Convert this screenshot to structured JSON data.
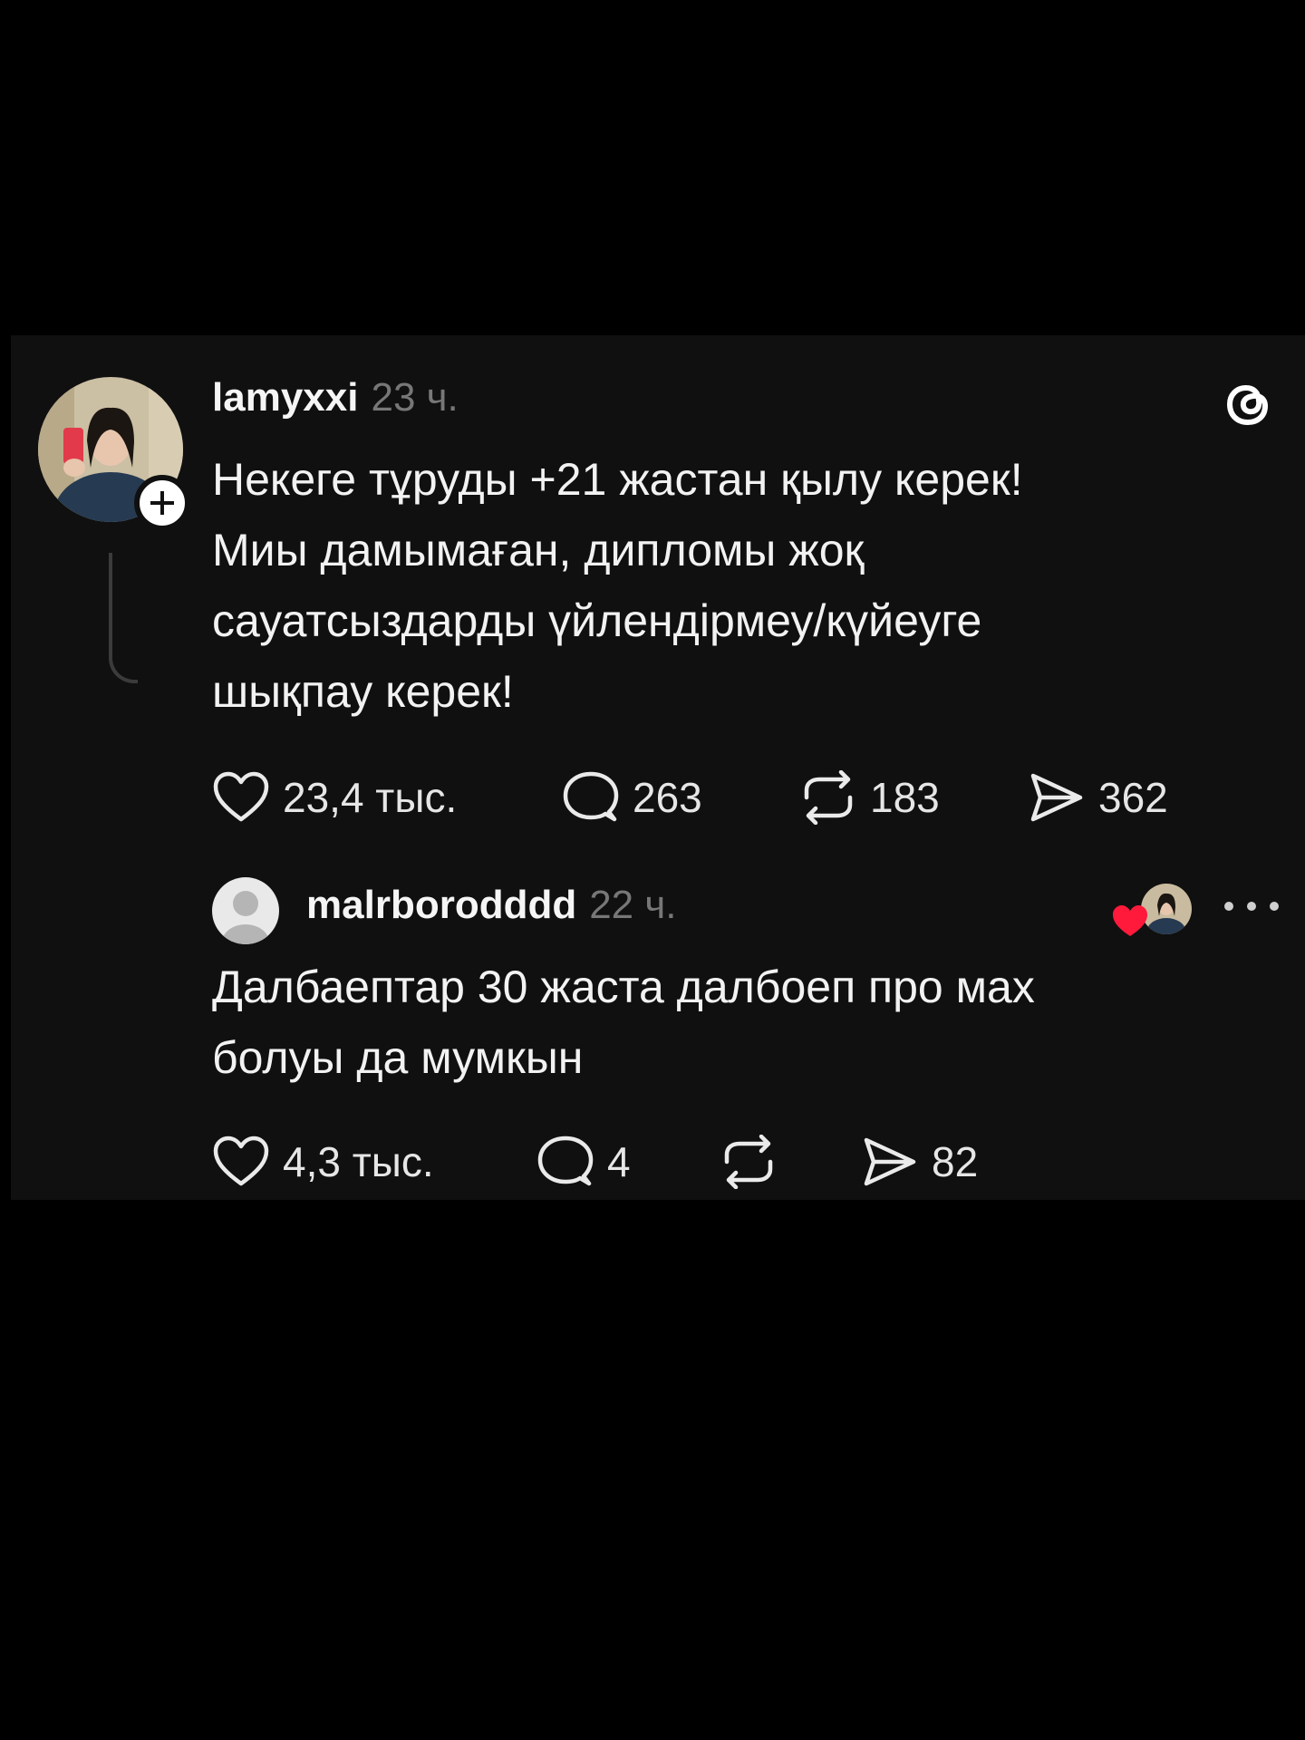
{
  "post": {
    "username": "lamyxxi",
    "time": "23 ч.",
    "text": "Некеге тұруды +21 жастан қылу керек!\nМиы дамымаған, дипломы жоқ\nсауатсыздарды үйлендірмеу/күйеуге\nшықпау керек!",
    "actions": {
      "likes": "23,4 тыс.",
      "comments": "263",
      "reposts": "183",
      "shares": "362"
    }
  },
  "reply": {
    "username": "malrborodddd",
    "time": "22 ч.",
    "text": "Далбаептар 30 жаста далбоеп про мах\nболуы да мумкын",
    "actions": {
      "likes": "4,3 тыс.",
      "comments": "4",
      "reposts": "",
      "shares": "82"
    }
  },
  "icons": [
    "threads-logo-icon",
    "heart-icon",
    "comment-icon",
    "repost-icon",
    "share-icon",
    "more-icon",
    "follow-plus-icon",
    "heart-badge-icon"
  ],
  "colors": {
    "background": "#000000",
    "card": "#101010",
    "text": "#f3f3f3",
    "muted": "#777777",
    "badge_heart": "#ff1a3c"
  }
}
